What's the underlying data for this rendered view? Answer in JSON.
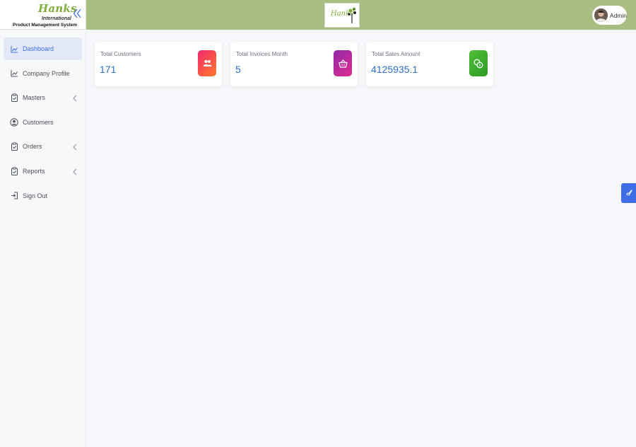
{
  "brand": {
    "name": "Hanks",
    "subtitle": "International",
    "tagline": "Product Management System"
  },
  "sidebar": {
    "items": [
      {
        "label": "Dashboard",
        "icon": "line-chart-icon",
        "active": true
      },
      {
        "label": "Company Profile",
        "icon": "line-chart-icon"
      },
      {
        "label": "Masters",
        "icon": "clipboard-check-icon",
        "has_submenu": true
      },
      {
        "label": "Customers",
        "icon": "user-circle-icon"
      },
      {
        "label": "Orders",
        "icon": "clipboard-check-icon",
        "has_submenu": true
      },
      {
        "label": "Reports",
        "icon": "clipboard-check-icon",
        "has_submenu": true
      },
      {
        "label": "Sign Out",
        "icon": "sign-out-icon"
      }
    ]
  },
  "header": {
    "logo_text": "Hanks",
    "user_name": "Admin"
  },
  "cards": [
    {
      "title": "Total Customers",
      "value": "171",
      "icon": "users-icon"
    },
    {
      "title": "Total Invoices Month",
      "value": "5",
      "icon": "basket-icon"
    },
    {
      "title": "Total Sales Amount",
      "value": "4125935.1",
      "icon": "coins-icon"
    }
  ],
  "colors": {
    "header_bg": "#a8bd80",
    "accent": "#3b6fe0",
    "value_text": "#2c6fc9"
  }
}
